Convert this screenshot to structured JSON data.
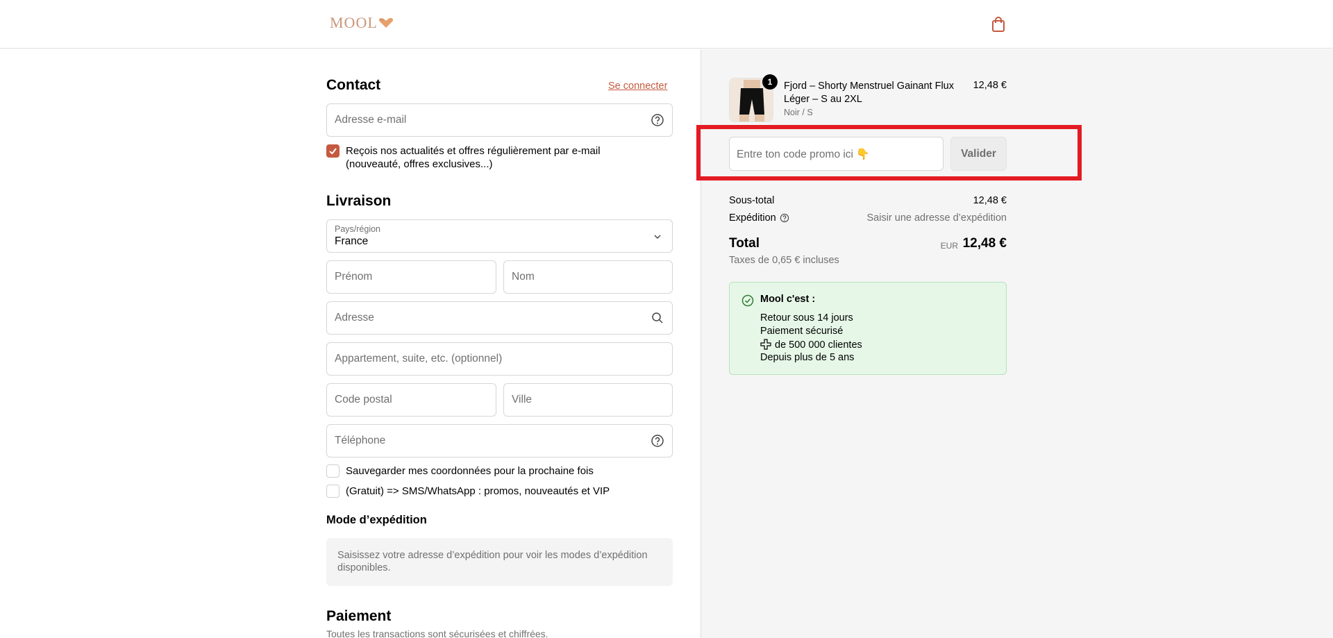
{
  "header": {
    "logo_text": "MOOL",
    "brand_color": "#c9967a"
  },
  "contact": {
    "title": "Contact",
    "login_link": "Se connecter",
    "email_placeholder": "Adresse e-mail",
    "newsletter_label_line1": "Reçois nos actualités et offres régulièrement par e-mail",
    "newsletter_label_line2": "(nouveauté, offres exclusives...)",
    "newsletter_checked": true
  },
  "delivery": {
    "title": "Livraison",
    "country_label": "Pays/région",
    "country_value": "France",
    "first_name_placeholder": "Prénom",
    "last_name_placeholder": "Nom",
    "address_placeholder": "Adresse",
    "apartment_placeholder": "Appartement, suite, etc. (optionnel)",
    "postal_code_placeholder": "Code postal",
    "city_placeholder": "Ville",
    "phone_placeholder": "Téléphone",
    "save_info_label": "Sauvegarder mes coordonnées pour la prochaine fois",
    "sms_label": "(Gratuit) => SMS/WhatsApp : promos, nouveautés et VIP"
  },
  "shipping_method": {
    "title": "Mode d’expédition",
    "notice": "Saisissez votre adresse d’expédition pour voir les modes d’expédition disponibles."
  },
  "payment": {
    "title": "Paiement",
    "subtitle": "Toutes les transactions sont sécurisées et chiffrées."
  },
  "order": {
    "item": {
      "quantity": "1",
      "name": "Fjord – Shorty Menstruel Gainant Flux Léger – S au 2XL",
      "variant": "Noir / S",
      "price": "12,48 €"
    },
    "promo_placeholder": "Entre ton code promo ici 👇",
    "validate_label": "Valider",
    "subtotal_label": "Sous-total",
    "subtotal_value": "12,48 €",
    "shipping_label": "Expédition",
    "shipping_value": "Saisir une adresse d’expédition",
    "total_label": "Total",
    "total_currency": "EUR",
    "total_value": "12,48 €",
    "tax_note": "Taxes de 0,65 € incluses"
  },
  "mool_box": {
    "title": "Mool c'est :",
    "line1": "Retour sous 14 jours",
    "line2": "Paiement sécurisé",
    "line3": "de 500 000 clientes",
    "line4": "Depuis plus de 5 ans"
  },
  "colors": {
    "accent": "#c5593f",
    "highlight": "#e31b23",
    "success_bg": "#e6f7e8"
  }
}
